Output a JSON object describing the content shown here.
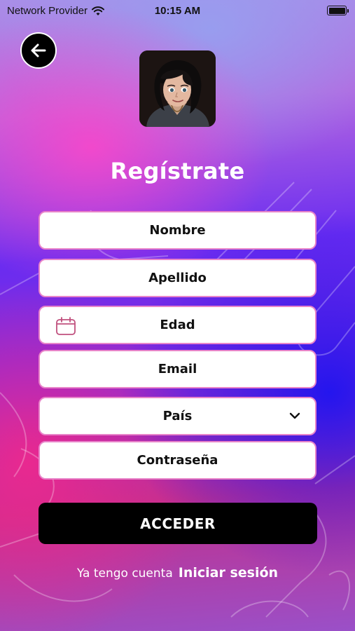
{
  "status_bar": {
    "carrier": "Network Provider",
    "time": "10:15 AM",
    "battery_level": 1.0
  },
  "header": {
    "back_icon": "arrow-left-icon",
    "avatar_description": "avatar"
  },
  "title": "Regístrate",
  "form": {
    "nombre": "Nombre",
    "apellido": "Apellido",
    "edad": "Edad",
    "edad_icon": "calendar-icon",
    "email": "Email",
    "pais": "País",
    "pais_icon": "chevron-down-icon",
    "contrasena": "Contraseña"
  },
  "submit_label": "ACCEDER",
  "footer": {
    "text": "Ya tengo cuenta",
    "link": "Iniciar sesión"
  },
  "colors": {
    "field_border": "#e884c9",
    "button_bg": "#000000",
    "title": "#ffffff"
  }
}
